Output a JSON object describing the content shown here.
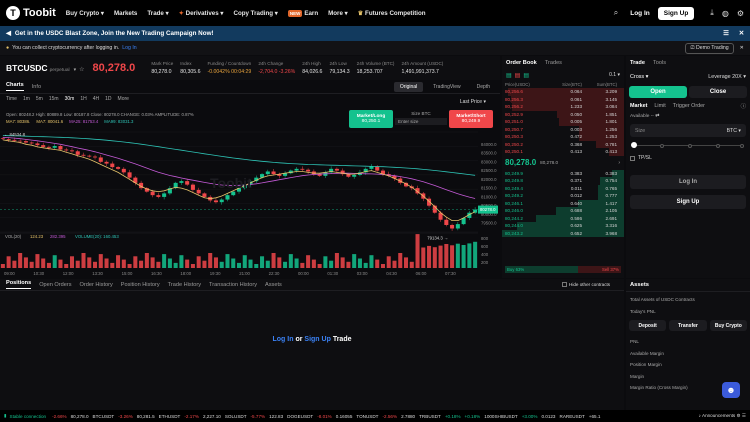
{
  "nav": {
    "brand": "Toobit",
    "items": [
      "Buy Crypto",
      "Markets",
      "Trade",
      "Derivatives",
      "Copy Trading",
      "Earn",
      "More",
      "Futures Competition"
    ],
    "earn_badge": "NEW",
    "login": "Log In",
    "signup": "Sign Up"
  },
  "banner": {
    "text": "Get in the USDC Blast Zone, Join the New Trading Campaign Now!"
  },
  "notice": {
    "text": "You can collect cryptocurrency after logging in.",
    "link": "Log In",
    "demo": "Demo Trading"
  },
  "symbol": {
    "name": "BTCUSDC",
    "type": "perpetual",
    "price": "80,278.0",
    "stats": [
      {
        "k": "Mark Price",
        "v": "80,278.0",
        "c": ""
      },
      {
        "k": "Index",
        "v": "80,305.6",
        "c": ""
      },
      {
        "k": "Funding / Countdown",
        "v": "-0.0042% 00:04:29",
        "c": "orange"
      },
      {
        "k": "24h Change",
        "v": "-2,704.0 -3.26%",
        "c": "red"
      },
      {
        "k": "24h High",
        "v": "84,026.6",
        "c": ""
      },
      {
        "k": "24h Low",
        "v": "79,134.3",
        "c": ""
      },
      {
        "k": "24h Volume (BTC)",
        "v": "18,253.707",
        "c": ""
      },
      {
        "k": "24h Amount (USDC)",
        "v": "1,491,991,373.7",
        "c": ""
      }
    ]
  },
  "chart": {
    "tabs": [
      "Charts",
      "Info"
    ],
    "views": [
      "Original",
      "TradingView",
      "Depth"
    ],
    "intervals": [
      "Time",
      "1m",
      "5m",
      "15m",
      "30m",
      "1H",
      "4H",
      "1D",
      "More"
    ],
    "last_price_label": "Last Price",
    "ohlc": "Open: 80248.2   High: 80889.8   Low: 80187.8   Close: 80278.0   CHANGE: 0.03%   AMPLITUDE: 0.87%",
    "ma": [
      "MA7: 80386.",
      "MA7: 80041.6",
      "MA25: 81753.4",
      "MA99: 83031.3"
    ],
    "ma_colors": [
      "#e6c36a",
      "#e6c36a",
      "#c45ad6",
      "#2ec4b6"
    ],
    "market_long": "Market/Long",
    "long_price": "80,250.1",
    "size_label": "Size BTC",
    "size_placeholder": "Enter size",
    "market_short": "Market/Short",
    "short_price": "80,249.9",
    "high_marker": "84534.8",
    "low_marker": "79134.3",
    "y_ticks": [
      "84000.0",
      "83500.0",
      "83000.0",
      "82500.0",
      "82000.0",
      "81500.0",
      "81000.0",
      "80500.0",
      "80000.0",
      "79500.0"
    ],
    "current_tag": "80278.0",
    "vol_label": "VOL(20)",
    "vol_vals": [
      "124.23",
      "282.395",
      "VOLUME(20): 160.453"
    ],
    "vol_ticks": [
      "800",
      "600",
      "400",
      "200"
    ],
    "x_ticks": [
      "09:00",
      "10:30",
      "12:00",
      "13:30",
      "15:00",
      "16:30",
      "18:00",
      "19:30",
      "21:00",
      "22:30",
      "00:00",
      "01:30",
      "03:00",
      "04:30",
      "06:00",
      "07:30"
    ],
    "close_series": [
      84300,
      84250,
      84200,
      84180,
      84100,
      84050,
      83950,
      83850,
      83800,
      83900,
      83700,
      83650,
      83600,
      83400,
      83350,
      83300,
      83250,
      83000,
      82900,
      82700,
      82600,
      82400,
      82100,
      81800,
      81500,
      81300,
      81100,
      81000,
      81200,
      81500,
      81800,
      81900,
      81700,
      81400,
      81200,
      81000,
      80800,
      80700,
      80850,
      81100,
      81300,
      81500,
      81700,
      81900,
      82100,
      82300,
      82450,
      82300,
      82200,
      82350,
      82500,
      82600,
      82550,
      82450,
      82300,
      82200,
      82400,
      82600,
      82500,
      82300,
      82150,
      82250,
      82400,
      82600,
      82750,
      82500,
      82300,
      82200,
      82050,
      81800,
      81600,
      81500,
      81200,
      80900,
      80500,
      80100,
      79700,
      79400,
      79200,
      79450,
      79800,
      80100,
      80278
    ],
    "ma7_series": [
      84250,
      84200,
      84150,
      84100,
      84000,
      83950,
      83850,
      83800,
      83750,
      83700,
      83650,
      83550,
      83450,
      83350,
      83250,
      83150,
      83000,
      82850,
      82700,
      82550,
      82400,
      82200,
      82000,
      81800,
      81600,
      81450,
      81350,
      81300,
      81350,
      81450,
      81550,
      81500,
      81400,
      81250,
      81100,
      80950,
      80900,
      80950,
      81050,
      81200,
      81350,
      81500,
      81650,
      81800,
      81950,
      82100,
      82200,
      82250,
      82300,
      82350,
      82400,
      82450,
      82450,
      82400,
      82350,
      82350,
      82400,
      82450,
      82400,
      82350,
      82300,
      82300,
      82350,
      82450,
      82500,
      82400,
      82300,
      82200,
      82050,
      81900,
      81750,
      81550,
      81300,
      81050,
      80750,
      80450,
      80100,
      79850,
      79650,
      79650,
      79800,
      80000,
      80150
    ],
    "ma25_series": [
      84400,
      84380,
      84350,
      84320,
      84280,
      84240,
      84200,
      84150,
      84100,
      84050,
      84000,
      83930,
      83860,
      83790,
      83720,
      83650,
      83570,
      83480,
      83390,
      83300,
      83200,
      83100,
      82990,
      82880,
      82760,
      82640,
      82520,
      82410,
      82310,
      82220,
      82150,
      82080,
      82010,
      81950,
      81890,
      81830,
      81770,
      81720,
      81680,
      81660,
      81650,
      81660,
      81680,
      81710,
      81750,
      81800,
      81860,
      81920,
      81980,
      82040,
      82100,
      82160,
      82210,
      82250,
      82280,
      82300,
      82320,
      82330,
      82340,
      82350,
      82350,
      82340,
      82330,
      82320,
      82310,
      82300,
      82280,
      82250,
      82210,
      82160,
      82100,
      82030,
      81950,
      81860,
      81760,
      81650,
      81530,
      81410,
      81290,
      81180,
      81080,
      80990,
      80910
    ],
    "ma99_series": [
      84500,
      84490,
      84480,
      84470,
      84460,
      84450,
      84440,
      84430,
      84420,
      84410,
      84400,
      84385,
      84370,
      84350,
      84330,
      84310,
      84285,
      84260,
      84230,
      84200,
      84165,
      84130,
      84090,
      84050,
      84005,
      83960,
      83910,
      83860,
      83810,
      83760,
      83710,
      83660,
      83610,
      83560,
      83510,
      83460,
      83410,
      83360,
      83310,
      83265,
      83220,
      83180,
      83140,
      83100,
      83065,
      83030,
      83000,
      82970,
      82945,
      82920,
      82900,
      82880,
      82865,
      82850,
      82840,
      82830,
      82820,
      82810,
      82800,
      82790,
      82780,
      82770,
      82760,
      82750,
      82740,
      82730,
      82720,
      82705,
      82690,
      82670,
      82650,
      82625,
      82600,
      82570,
      82540,
      82505,
      82470,
      82430,
      82390,
      82350,
      82310,
      82270,
      82230
    ]
  },
  "orderbook": {
    "tabs": [
      "Order Book",
      "Trades"
    ],
    "precision": "0.1",
    "headers": [
      "Price(USDC)",
      "Size(BTC)",
      "Sum(BTC)"
    ],
    "asks": [
      [
        "80,256.6",
        "0.064",
        "3.209",
        0.95
      ],
      [
        "80,256.3",
        "0.061",
        "3.145",
        0.93
      ],
      [
        "80,256.2",
        "1.233",
        "3.084",
        0.92
      ],
      [
        "80,252.9",
        "0.050",
        "1.851",
        0.55
      ],
      [
        "80,251.0",
        "0.005",
        "1.801",
        0.53
      ],
      [
        "80,250.7",
        "0.003",
        "1.256",
        0.37
      ],
      [
        "80,250.3",
        "0.472",
        "1.253",
        0.37
      ],
      [
        "80,250.2",
        "0.368",
        "0.781",
        0.23
      ],
      [
        "80,250.1",
        "0.413",
        "0.413",
        0.12
      ]
    ],
    "mid_price": "80,278.0",
    "mid_sub": "80,278.0",
    "bids": [
      [
        "80,249.9",
        "0.383",
        "0.383",
        0.1
      ],
      [
        "80,249.8",
        "0.371",
        "0.754",
        0.2
      ],
      [
        "80,249.4",
        "0.011",
        "0.765",
        0.21
      ],
      [
        "80,249.2",
        "0.012",
        "0.777",
        0.21
      ],
      [
        "80,246.1",
        "0.640",
        "1.417",
        0.38
      ],
      [
        "80,246.0",
        "0.688",
        "2.105",
        0.56
      ],
      [
        "80,244.2",
        "0.586",
        "2.691",
        0.72
      ],
      [
        "80,244.0",
        "0.625",
        "3.316",
        0.88
      ],
      [
        "80,243.2",
        "0.652",
        "3.968",
        1.0
      ]
    ],
    "buy_pct": "Buy 63%",
    "sell_pct": "Sell 37%",
    "buy_ratio": 0.63
  },
  "trade": {
    "tabs": [
      "Trade",
      "Tools"
    ],
    "margin_mode": "Cross",
    "leverage": "Leverage 20X",
    "open": "Open",
    "close": "Close",
    "order_types": [
      "Market",
      "Limit",
      "Trigger Order"
    ],
    "available": "Available --",
    "size_placeholder": "Size",
    "size_unit": "BTC",
    "tpsl": "TP/SL",
    "login": "Log In",
    "signup": "Sign Up"
  },
  "bottom": {
    "tabs": [
      "Positions",
      "Open Orders",
      "Order History",
      "Position History",
      "Trade History",
      "Transaction History",
      "Assets"
    ],
    "hide_other": "Hide other contracts",
    "login": "Log In",
    "or": "or",
    "signup": "Sign Up",
    "trade": "Trade"
  },
  "assets": {
    "title": "Assets",
    "total": "Total Assets of USDC Contracts",
    "pnl": "Today's PNL",
    "buttons": [
      "Deposit",
      "Transfer",
      "Buy Crypto"
    ],
    "rows": [
      "PNL",
      "Available Margin",
      "Position Margin",
      "Margin",
      "Margin Ratio (Cross Margin)"
    ]
  },
  "ticker": {
    "status": "Stable connection",
    "items": [
      [
        "-2.66%",
        "80,278.0"
      ],
      [
        "BTCUSDT",
        "-3.26%"
      ],
      [
        "80,281.5",
        "ETHUSDT"
      ],
      [
        "-2.17%",
        "2,227.10"
      ],
      [
        "SOLUSDT",
        "-5.77%"
      ],
      [
        "122.83",
        "DOGEUSDT"
      ],
      [
        "-8.01%",
        "0.16055"
      ],
      [
        "TONUSDT",
        "-2.56%"
      ],
      [
        "2.7880",
        "TRBUSDT"
      ],
      [
        "+0.18%",
        "+0.18%"
      ],
      [
        "1000SHIBUSDT",
        "+3.00%"
      ],
      [
        "0.0123"
      ],
      [
        "RAREUSDT",
        "+65.1"
      ]
    ],
    "announcements": "Announcements"
  }
}
